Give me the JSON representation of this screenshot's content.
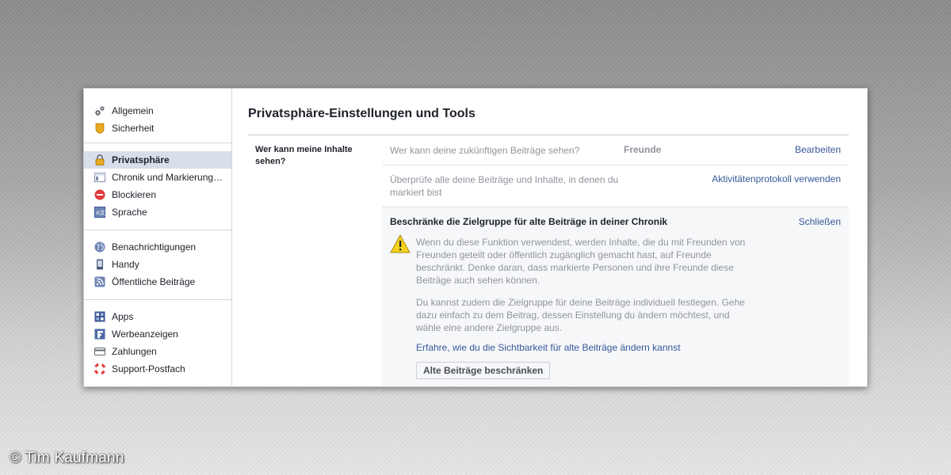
{
  "sidebar": {
    "groups": [
      [
        {
          "label": "Allgemein",
          "icon": "gears-icon"
        },
        {
          "label": "Sicherheit",
          "icon": "shield-icon"
        }
      ],
      [
        {
          "label": "Privatsphäre",
          "icon": "lock-icon",
          "active": true
        },
        {
          "label": "Chronik und Markierung…",
          "icon": "timeline-icon"
        },
        {
          "label": "Blockieren",
          "icon": "block-icon"
        },
        {
          "label": "Sprache",
          "icon": "language-icon"
        }
      ],
      [
        {
          "label": "Benachrichtigungen",
          "icon": "globe-icon"
        },
        {
          "label": "Handy",
          "icon": "phone-icon"
        },
        {
          "label": "Öffentliche Beiträge",
          "icon": "rss-icon"
        }
      ],
      [
        {
          "label": "Apps",
          "icon": "apps-icon"
        },
        {
          "label": "Werbeanzeigen",
          "icon": "ads-icon"
        },
        {
          "label": "Zahlungen",
          "icon": "card-icon"
        },
        {
          "label": "Support-Postfach",
          "icon": "lifebuoy-icon"
        }
      ]
    ]
  },
  "main": {
    "title": "Privatsphäre-Einstellungen und Tools",
    "section_label": "Wer kann meine Inhalte sehen?",
    "row1": {
      "question": "Wer kann deine zukünftigen Beiträge sehen?",
      "value": "Freunde",
      "action": "Bearbeiten"
    },
    "row2": {
      "question": "Überprüfe alle deine Beiträge und Inhalte, in denen du markiert bist",
      "action": "Aktivitätenprotokoll verwenden"
    },
    "expanded": {
      "title": "Beschränke die Zielgruppe für alte Beiträge in deiner Chronik",
      "close": "Schließen",
      "para1": "Wenn du diese Funktion verwendest, werden Inhalte, die du mit Freunden von Freunden geteilt oder öffentlich zugänglich gemacht hast, auf Freunde beschränkt. Denke daran, dass markierte Personen und ihre Freunde diese Beiträge auch sehen können.",
      "para2": "Du kannst zudem die Zielgruppe für deine Beiträge individuell festlegen. Gehe dazu einfach zu dem Beitrag, dessen Einstellung du ändern möchtest, und wähle eine andere Zielgruppe aus.",
      "learn_link": "Erfahre, wie du die Sichtbarkeit für alte Beiträge ändern kannst",
      "button": "Alte Beiträge beschränken"
    }
  },
  "credit": "© Tim Kaufmann",
  "colors": {
    "link": "#365899",
    "active_bg": "#d8dfea",
    "muted_text": "#90949c",
    "panel_bg": "#f6f7f9"
  }
}
